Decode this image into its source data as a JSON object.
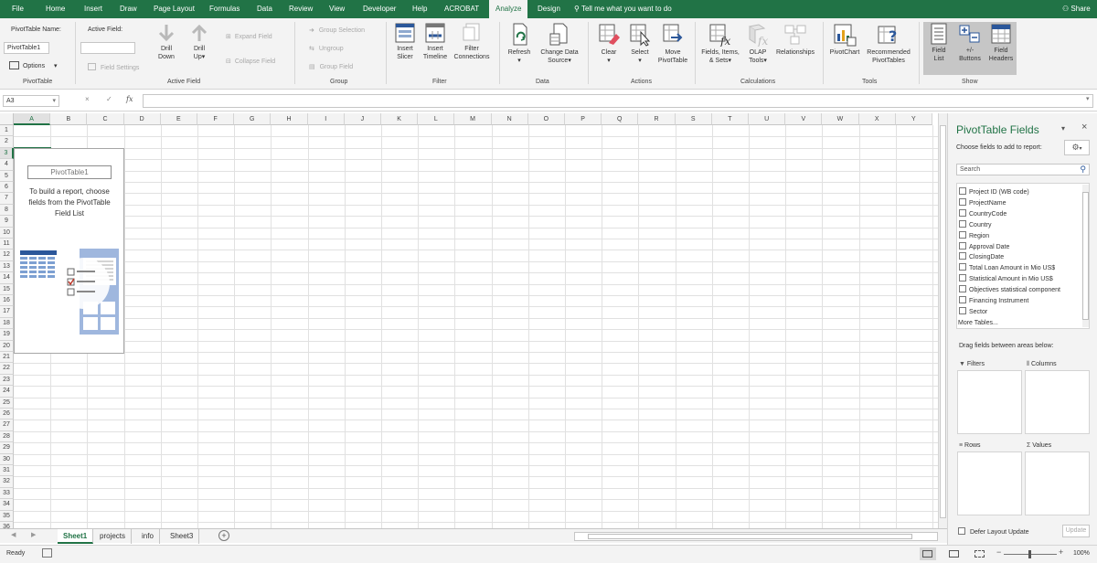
{
  "menu": {
    "tabs": [
      "File",
      "Home",
      "Insert",
      "Draw",
      "Page Layout",
      "Formulas",
      "Data",
      "Review",
      "View",
      "Developer",
      "Help",
      "ACROBAT",
      "Analyze",
      "Design"
    ],
    "active_tab": "Analyze",
    "tell_me": "Tell me what you want to do",
    "share": "Share"
  },
  "ribbon": {
    "pivottable": {
      "name_label": "PivotTable Name:",
      "name_value": "PivotTable1",
      "options_label": "Options",
      "group_label": "PivotTable"
    },
    "active_field": {
      "label": "Active Field:",
      "value": "",
      "field_settings": "Field Settings",
      "drill_down_1": "Drill",
      "drill_down_2": "Down",
      "drill_up_1": "Drill",
      "drill_up_2": "Up",
      "expand_field": "Expand Field",
      "collapse_field": "Collapse Field",
      "group_label": "Active Field"
    },
    "group": {
      "group_selection": "Group Selection",
      "ungroup": "Ungroup",
      "group_field": "Group Field",
      "group_label": "Group"
    },
    "filter": {
      "insert_slicer_1": "Insert",
      "insert_slicer_2": "Slicer",
      "insert_timeline_1": "Insert",
      "insert_timeline_2": "Timeline",
      "filter_connections_1": "Filter",
      "filter_connections_2": "Connections",
      "group_label": "Filter"
    },
    "data": {
      "refresh": "Refresh",
      "change_source_1": "Change Data",
      "change_source_2": "Source",
      "group_label": "Data"
    },
    "actions": {
      "clear": "Clear",
      "select": "Select",
      "move_1": "Move",
      "move_2": "PivotTable",
      "group_label": "Actions"
    },
    "calculations": {
      "fields_1": "Fields, Items,",
      "fields_2": "& Sets",
      "olap_1": "OLAP",
      "olap_2": "Tools",
      "relationships": "Relationships",
      "group_label": "Calculations"
    },
    "tools": {
      "pivotchart": "PivotChart",
      "recommended_1": "Recommended",
      "recommended_2": "PivotTables",
      "group_label": "Tools"
    },
    "show": {
      "field_list_1": "Field",
      "field_list_2": "List",
      "buttons_1": "+/-",
      "buttons_2": "Buttons",
      "headers_1": "Field",
      "headers_2": "Headers",
      "group_label": "Show"
    }
  },
  "formula_bar": {
    "name_box": "A3",
    "cancel": "×",
    "enter": "✓",
    "fx": "fx",
    "value": ""
  },
  "grid": {
    "columns": [
      "A",
      "B",
      "C",
      "D",
      "E",
      "F",
      "G",
      "H",
      "I",
      "J",
      "K",
      "L",
      "M",
      "N",
      "O",
      "P",
      "Q",
      "R",
      "S",
      "T",
      "U",
      "V",
      "W",
      "X",
      "Y"
    ],
    "rows": [
      "1",
      "2",
      "3",
      "4",
      "5",
      "6",
      "7",
      "8",
      "9",
      "10",
      "11",
      "12",
      "13",
      "14",
      "15",
      "16",
      "17",
      "18",
      "19",
      "20",
      "21",
      "22",
      "23",
      "24",
      "25",
      "26",
      "27",
      "28",
      "29",
      "30",
      "31",
      "32",
      "33",
      "34",
      "35",
      "36"
    ],
    "selected_column": "A",
    "selected_row": "3"
  },
  "pivot_placeholder": {
    "name": "PivotTable1",
    "hint": "To build a report, choose fields from the PivotTable Field List"
  },
  "sheets": {
    "tabs": [
      "Sheet1",
      "projects",
      "info",
      "Sheet3"
    ],
    "active": "Sheet1",
    "add": "+"
  },
  "status": {
    "ready": "Ready",
    "zoom": "100%"
  },
  "pane": {
    "title": "PivotTable Fields",
    "choose_label": "Choose fields to add to report:",
    "search_placeholder": "Search",
    "fields": [
      "Project ID (WB code)",
      "ProjectName",
      "CountryCode",
      "Country",
      "Region",
      "Approval Date",
      "ClosingDate",
      "Total Loan Amount in Mio US$",
      "Statistical Amount in Mio US$",
      "Objectives statistical component",
      "Financing Instrument",
      "Sector"
    ],
    "more_tables": "More Tables...",
    "drag_label": "Drag fields between areas below:",
    "areas": {
      "filters": "Filters",
      "columns": "Columns",
      "rows": "Rows",
      "values": "Values"
    },
    "defer_label": "Defer Layout Update",
    "update_button": "Update"
  }
}
